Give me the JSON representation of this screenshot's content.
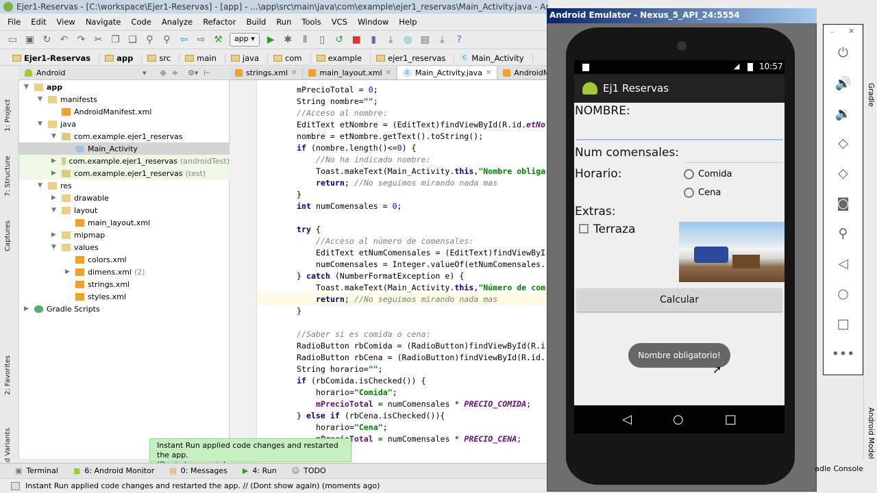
{
  "window": {
    "title": "Ejer1-Reservas - [C:\\workspace\\Ejer1-Reservas] - [app] - ...\\app\\src\\main\\java\\com\\example\\ejer1_reservas\\Main_Activity.java - Android Studio"
  },
  "menu": [
    "File",
    "Edit",
    "View",
    "Navigate",
    "Code",
    "Analyze",
    "Refactor",
    "Build",
    "Run",
    "Tools",
    "VCS",
    "Window",
    "Help"
  ],
  "toolbar": {
    "run_config": "app"
  },
  "breadcrumb": [
    "Ejer1-Reservas",
    "app",
    "src",
    "main",
    "java",
    "com",
    "example",
    "ejer1_reservas",
    "Main_Activity"
  ],
  "project": {
    "view_mode": "Android",
    "tree": [
      {
        "label": "app",
        "level": 0,
        "arrow": "down",
        "bold": true,
        "icon": "folder"
      },
      {
        "label": "manifests",
        "level": 1,
        "arrow": "down",
        "icon": "folder"
      },
      {
        "label": "AndroidManifest.xml",
        "level": 2,
        "icon": "xml"
      },
      {
        "label": "java",
        "level": 1,
        "arrow": "down",
        "icon": "folder"
      },
      {
        "label": "com.example.ejer1_reservas",
        "level": 2,
        "arrow": "down",
        "icon": "package"
      },
      {
        "label": "Main_Activity",
        "level": 3,
        "icon": "class",
        "selected": true
      },
      {
        "label": "com.example.ejer1_reservas",
        "extra": "(androidTest)",
        "level": 2,
        "arrow": "right",
        "icon": "package",
        "test": true
      },
      {
        "label": "com.example.ejer1_reservas",
        "extra": "(test)",
        "level": 2,
        "arrow": "right",
        "icon": "package",
        "test": true
      },
      {
        "label": "res",
        "level": 1,
        "arrow": "down",
        "icon": "folder"
      },
      {
        "label": "drawable",
        "level": 2,
        "arrow": "right",
        "icon": "folder"
      },
      {
        "label": "layout",
        "level": 2,
        "arrow": "down",
        "icon": "folder"
      },
      {
        "label": "main_layout.xml",
        "level": 3,
        "icon": "xml"
      },
      {
        "label": "mipmap",
        "level": 2,
        "arrow": "right",
        "icon": "folder"
      },
      {
        "label": "values",
        "level": 2,
        "arrow": "down",
        "icon": "folder"
      },
      {
        "label": "colors.xml",
        "level": 3,
        "icon": "xml"
      },
      {
        "label": "dimens.xml",
        "extra": "(2)",
        "level": 3,
        "arrow": "right",
        "icon": "xml"
      },
      {
        "label": "strings.xml",
        "level": 3,
        "icon": "xml"
      },
      {
        "label": "styles.xml",
        "level": 3,
        "icon": "xml"
      },
      {
        "label": "Gradle Scripts",
        "level": 0,
        "arrow": "right",
        "icon": "gradle"
      }
    ]
  },
  "tabs": [
    {
      "label": "strings.xml",
      "icon": "xml"
    },
    {
      "label": "main_layout.xml",
      "icon": "xml"
    },
    {
      "label": "Main_Activity.java",
      "icon": "class",
      "active": true
    },
    {
      "label": "AndroidManifest.xml",
      "icon": "xml"
    }
  ],
  "left_strip": [
    "1: Project",
    "7: Structure",
    "Captures",
    "2: Favorites",
    "Build Variants"
  ],
  "right_strip": [
    "Gradle",
    "Android Model"
  ],
  "code": [
    [
      0,
      [
        [
          "",
          "mPrecioTotal = "
        ],
        [
          "nm",
          "0"
        ],
        [
          "",
          ";"
        ]
      ]
    ],
    [
      0,
      [
        [
          "",
          "String nombre="
        ],
        [
          "st",
          "\"\""
        ],
        [
          "",
          ";"
        ]
      ]
    ],
    [
      0,
      [
        [
          "cm",
          "//Acceso al nombre:"
        ]
      ]
    ],
    [
      0,
      [
        [
          "",
          "EditText etNombre = (EditText)findViewById(R.id."
        ],
        [
          "cs",
          "etNo"
        ]
      ]
    ],
    [
      0,
      [
        [
          "",
          "nombre = etNombre.getText().toString();"
        ]
      ]
    ],
    [
      0,
      [
        [
          "kw",
          "if"
        ],
        [
          "",
          " (nombre.length()<="
        ],
        [
          "nm",
          "0"
        ],
        [
          "",
          ") {"
        ]
      ]
    ],
    [
      1,
      [
        [
          "cm",
          "//No ha indicado nombre:"
        ]
      ]
    ],
    [
      1,
      [
        [
          "",
          "Toast.makeText(Main_Activity."
        ],
        [
          "kw",
          "this"
        ],
        [
          "",
          ","
        ],
        [
          "st",
          "\"Nombre obliga"
        ]
      ]
    ],
    [
      1,
      [
        [
          "kw",
          "return"
        ],
        [
          "",
          "; "
        ],
        [
          "cm",
          "//No seguimos mirando nada mas"
        ]
      ]
    ],
    [
      0,
      [
        [
          "",
          "}"
        ]
      ]
    ],
    [
      0,
      [
        [
          "kw",
          "int"
        ],
        [
          "",
          " numComensales = "
        ],
        [
          "nm",
          "0"
        ],
        [
          "",
          ";"
        ]
      ]
    ],
    [
      0,
      []
    ],
    [
      0,
      [
        [
          "kw",
          "try"
        ],
        [
          "",
          " {"
        ]
      ]
    ],
    [
      1,
      [
        [
          "cm",
          "//Acceso al número de comensales:"
        ]
      ]
    ],
    [
      1,
      [
        [
          "",
          "EditText etNumComensales = (EditText)findViewByI"
        ]
      ]
    ],
    [
      1,
      [
        [
          "",
          "numComensales = Integer.valueOf(etNumComensales."
        ]
      ]
    ],
    [
      0,
      [
        [
          "",
          "} "
        ],
        [
          "kw",
          "catch"
        ],
        [
          "",
          " (NumberFormatException e) {"
        ]
      ]
    ],
    [
      1,
      [
        [
          "",
          "Toast.makeText(Main_Activity."
        ],
        [
          "kw",
          "this"
        ],
        [
          "",
          ","
        ],
        [
          "st",
          "\"Número de com"
        ]
      ]
    ],
    [
      1,
      [
        [
          "kw",
          "return"
        ],
        [
          "",
          "; "
        ],
        [
          "cm",
          "//No seguimos mirando nada mas"
        ]
      ]
    ],
    [
      0,
      [
        [
          "",
          "}"
        ]
      ]
    ],
    [
      0,
      []
    ],
    [
      0,
      [
        [
          "cm",
          "//Saber si es comida o cena:"
        ]
      ]
    ],
    [
      0,
      [
        [
          "",
          "RadioButton rbComida = (RadioButton)findViewById(R.i"
        ]
      ]
    ],
    [
      0,
      [
        [
          "",
          "RadioButton rbCena = (RadioButton)findViewById(R.id."
        ]
      ]
    ],
    [
      0,
      [
        [
          "",
          "String horario="
        ],
        [
          "st",
          "\"\""
        ],
        [
          "",
          ";"
        ]
      ]
    ],
    [
      0,
      [
        [
          "kw",
          "if"
        ],
        [
          "",
          " (rbComida.isChecked()) {"
        ]
      ]
    ],
    [
      1,
      [
        [
          "",
          "horario="
        ],
        [
          "st",
          "\"Comida\""
        ],
        [
          "",
          ";"
        ]
      ]
    ],
    [
      1,
      [
        [
          "fd",
          "mPrecioTotal"
        ],
        [
          "",
          " = numComensales * "
        ],
        [
          "cs",
          "PRECIO_COMIDA"
        ],
        [
          "",
          ";"
        ]
      ]
    ],
    [
      0,
      [
        [
          "",
          "} "
        ],
        [
          "kw",
          "else if"
        ],
        [
          "",
          " (rbCena.isChecked()){"
        ]
      ]
    ],
    [
      1,
      [
        [
          "",
          "horario="
        ],
        [
          "st",
          "\"Cena\""
        ],
        [
          "",
          ";"
        ]
      ]
    ],
    [
      1,
      [
        [
          "fd",
          "mPrecioTotal"
        ],
        [
          "",
          " = numComensales * "
        ],
        [
          "cs",
          "PRECIO_CENA"
        ],
        [
          "",
          ";"
        ]
      ]
    ]
  ],
  "balloon": {
    "text": "Instant Run applied code changes and restarted the app.",
    "link": "Dont show again"
  },
  "bottom_tools": [
    {
      "label": "Terminal",
      "icon": "terminal"
    },
    {
      "label": "6: Android Monitor",
      "icon": "android"
    },
    {
      "label": "0: Messages",
      "icon": "messages"
    },
    {
      "label": "4: Run",
      "icon": "run"
    },
    {
      "label": "TODO",
      "icon": "todo"
    }
  ],
  "status": {
    "text": "Instant Run applied code changes and restarted the app. // (Dont show again) (moments ago)"
  },
  "gradle_console": "Gradle Console",
  "emulator": {
    "title": "Android Emulator - Nexus_5_API_24:5554",
    "clock": "10:57",
    "app_title": "Ej1 Reservas",
    "nombre_label": "NOMBRE:",
    "nombre_value": "",
    "comensales_label": "Num comensales:",
    "comensales_value": "",
    "horario_label": "Horario:",
    "options": [
      {
        "label": "Comida",
        "checked": false
      },
      {
        "label": "Cena",
        "checked": false
      }
    ],
    "extras_label": "Extras:",
    "terraza_label": "Terraza",
    "terraza_checked": false,
    "calc_button": "Calcular",
    "toast": "Nombre obligatorio!",
    "controls": [
      "power",
      "volume-up",
      "volume-down",
      "rotate-left",
      "rotate-right",
      "camera",
      "zoom",
      "back",
      "home",
      "overview",
      "more"
    ]
  }
}
